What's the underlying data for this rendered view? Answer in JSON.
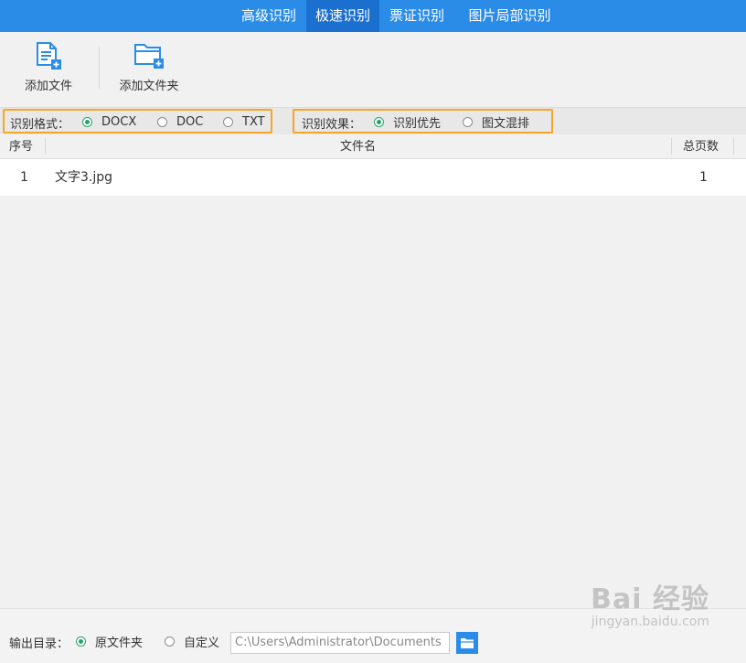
{
  "tabs": [
    {
      "label": "高级识别",
      "active": false
    },
    {
      "label": "极速识别",
      "active": true
    },
    {
      "label": "票证识别",
      "active": false
    },
    {
      "label": "图片局部识别",
      "active": false
    }
  ],
  "toolbar": {
    "add_file_label": "添加文件",
    "add_folder_label": "添加文件夹",
    "add_file_icon": "add-file-icon",
    "add_folder_icon": "add-folder-icon"
  },
  "format": {
    "label": "识别格式：",
    "options": [
      {
        "label": "DOCX",
        "selected": true
      },
      {
        "label": "DOC",
        "selected": false
      },
      {
        "label": "TXT",
        "selected": false
      }
    ]
  },
  "effect": {
    "label": "识别效果：",
    "options": [
      {
        "label": "识别优先",
        "selected": true
      },
      {
        "label": "图文混排",
        "selected": false
      }
    ]
  },
  "table": {
    "headers": {
      "index": "序号",
      "filename": "文件名",
      "pages": "总页数"
    },
    "rows": [
      {
        "index": "1",
        "filename": "文字3.jpg",
        "pages": "1"
      }
    ]
  },
  "output": {
    "label": "输出目录：",
    "options": [
      {
        "label": "原文件夹",
        "selected": true
      },
      {
        "label": "自定义",
        "selected": false
      }
    ],
    "path_value": "C:\\Users\\Administrator\\Documents"
  },
  "watermark": {
    "logo": "Bai 经验",
    "site": "jingyan.baidu.com"
  },
  "colors": {
    "header_blue": "#2b8ce8",
    "active_tab": "#1a6fcf",
    "highlight_border": "#f5a623",
    "radio_green": "#27a36b"
  }
}
